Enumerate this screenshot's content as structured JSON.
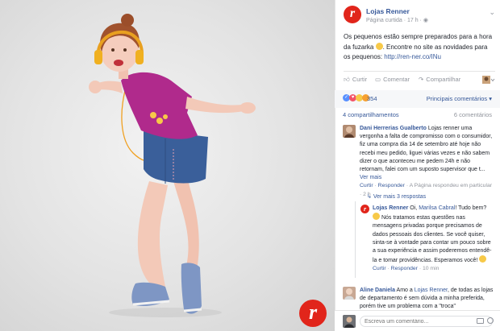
{
  "page": {
    "name": "Lojas Renner",
    "meta": "Página curtida · 17 h · ",
    "logo_letter": "r"
  },
  "post": {
    "text_1": "Os pequenos estão sempre preparados para a hora da fuzarka ",
    "text_2": ". Encontre no site as novidades para os pequenos: ",
    "link": "http://ren-ner.co/INu"
  },
  "actions": {
    "like": "Curtir",
    "comment": "Comentar",
    "share": "Compartilhar"
  },
  "stats": {
    "reaction_count": "354",
    "top_comments": "Principais comentários ▾",
    "shares": "4 compartilhamentos",
    "comments": "6 comentários"
  },
  "comments": [
    {
      "name": "Dani Herrerias Gualberto",
      "text": " Lojas renner uma vergonha a falta de compromisso com o consumidor, fiz uma compra dia 14 de setembro até hoje não recebi meu pedido, liguei várias vezes e não sabem dizer o que aconteceu me pedem 24h e não retornam, falei com um suposto supervisor que t...",
      "see_more": "Ver mais",
      "like": "Curtir",
      "reply": "Responder",
      "foot": " · A Página respondeu em particular · 2 h"
    }
  ],
  "more_replies": "Ver mais 3 respostas",
  "reply": {
    "name": "Lojas Renner",
    "mention": "Marilsa Cabral",
    "text_a": " Oi, ",
    "text_b": "! Tudo bem? ",
    "text_c": "Nós tratamos estas questões nas mensagens privadas porque precisamos de dados pessoais dos clientes. Se você quiser, sinta-se à vontade para contar um pouco sobre a sua experiência e assim poderemos entendê-la e tomar providências. Esperamos você! ",
    "like": "Curtir",
    "reply": "Responder",
    "time": " · 10 min"
  },
  "comment2": {
    "name": "Aline Daniela",
    "text_a": " Amo a ",
    "mention": "Lojas Renner",
    "text_b": ", de todas as lojas de departamento é sem dúvida a minha preferida, porém tive um problema com a \"troca\""
  },
  "input": {
    "placeholder": "Escreva um comentário..."
  },
  "colors": {
    "brand": "#e1251b",
    "link": "#365899",
    "muted": "#90949c"
  }
}
